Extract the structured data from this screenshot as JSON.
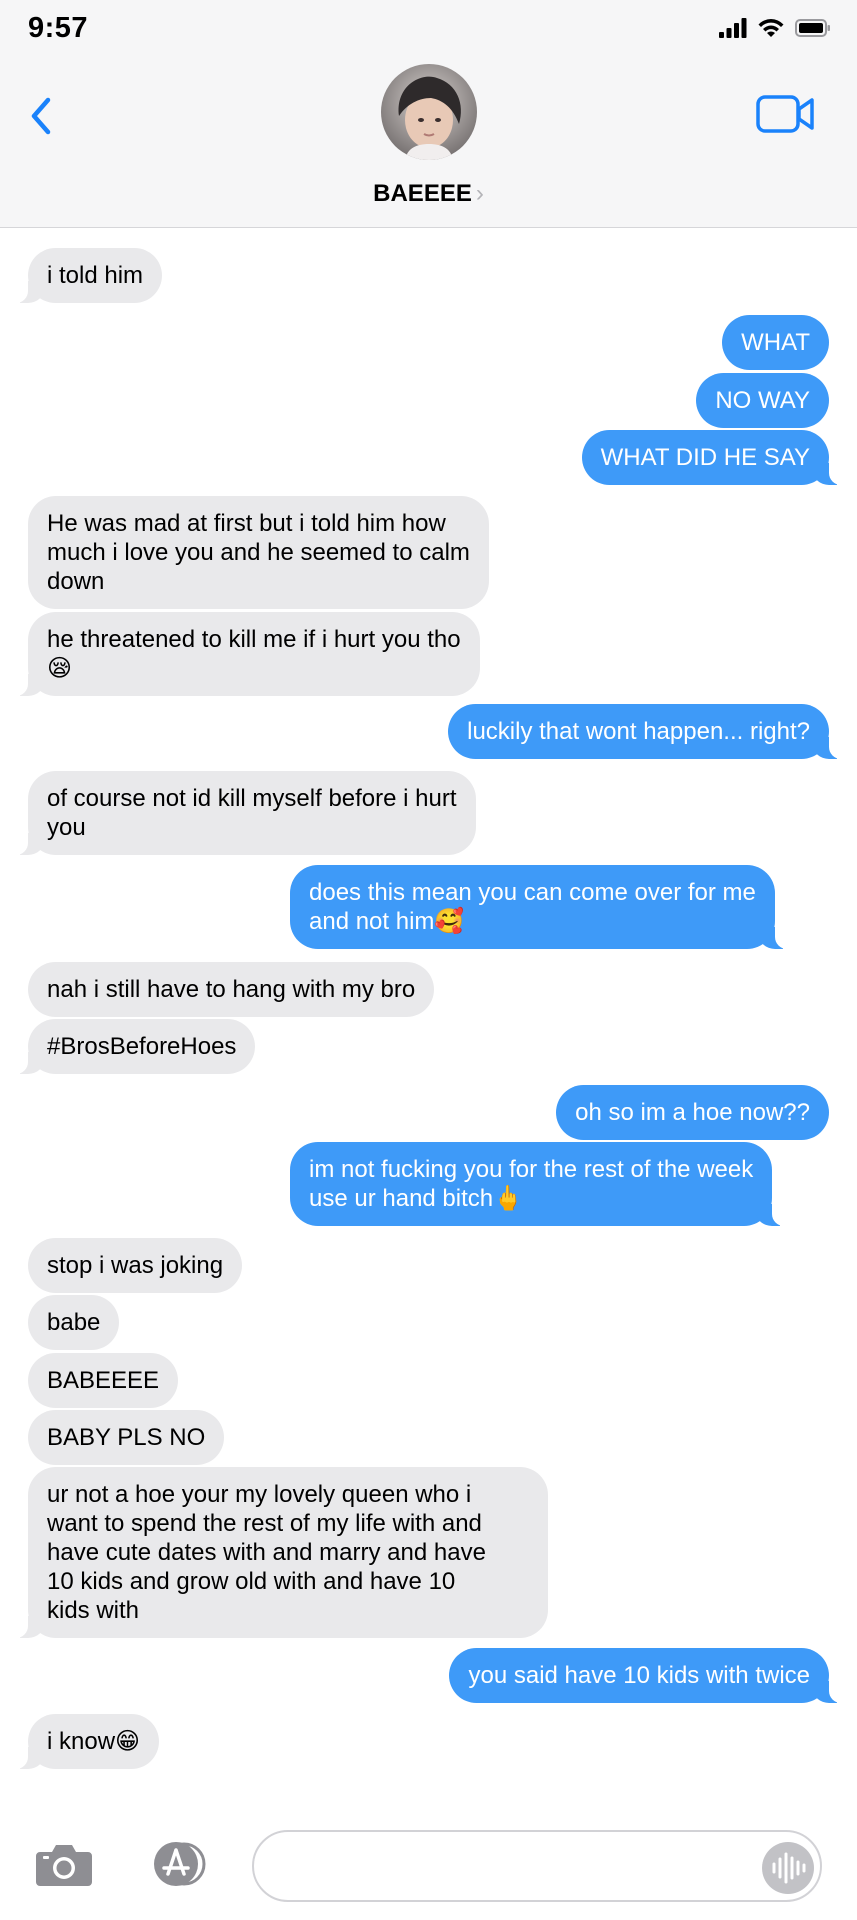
{
  "status": {
    "time": "9:57"
  },
  "header": {
    "contact_name": "BAEEEE",
    "chevron": "›"
  },
  "composer": {
    "placeholder": ""
  },
  "messages": [
    {
      "dir": "in",
      "text": "i told him"
    },
    {
      "dir": "out",
      "text": "WHAT"
    },
    {
      "dir": "out",
      "text": "NO WAY"
    },
    {
      "dir": "out",
      "text": "WHAT DID HE SAY"
    },
    {
      "dir": "in",
      "text": "He was mad at first but i told him how\nmuch i love you and he seemed to calm\ndown"
    },
    {
      "dir": "in",
      "text": "he threatened to kill me if i hurt you tho\n😪"
    },
    {
      "dir": "out",
      "text": "luckily that wont happen... right?"
    },
    {
      "dir": "in",
      "text": "of course not id kill myself before i hurt\nyou"
    },
    {
      "dir": "out",
      "text": "does this mean you can come over for me\nand not him🥰"
    },
    {
      "dir": "in",
      "text": "nah i still have to hang with my bro"
    },
    {
      "dir": "in",
      "text": "#BrosBeforeHoes"
    },
    {
      "dir": "out",
      "text": "oh so im a hoe now??"
    },
    {
      "dir": "out",
      "text": "im not fucking you for the rest of the week\nuse ur hand bitch🖕"
    },
    {
      "dir": "in",
      "text": "stop i was joking"
    },
    {
      "dir": "in",
      "text": "babe"
    },
    {
      "dir": "in",
      "text": "BABEEEE"
    },
    {
      "dir": "in",
      "text": "BABY PLS NO"
    },
    {
      "dir": "in",
      "text": "ur not a hoe your my lovely queen who i\nwant to spend the rest of my life with and\nhave cute dates with and marry and have\n10 kids and grow old with and have 10\nkids with"
    },
    {
      "dir": "out",
      "text": "you said have 10 kids with twice"
    },
    {
      "dir": "in",
      "text": "i know😁"
    }
  ],
  "colors": {
    "incoming_bubble": "#e9e9eb",
    "outgoing_bubble": "#3e9af8",
    "accent": "#1a82fb",
    "header_bg": "#f6f6f7"
  },
  "icons": {
    "back": "chevron-left-icon",
    "video": "video-camera-icon",
    "camera": "camera-icon",
    "apps": "app-store-icon",
    "audio": "audio-waveform-icon",
    "signal": "cellular-signal-icon",
    "wifi": "wifi-icon",
    "battery": "battery-icon"
  }
}
